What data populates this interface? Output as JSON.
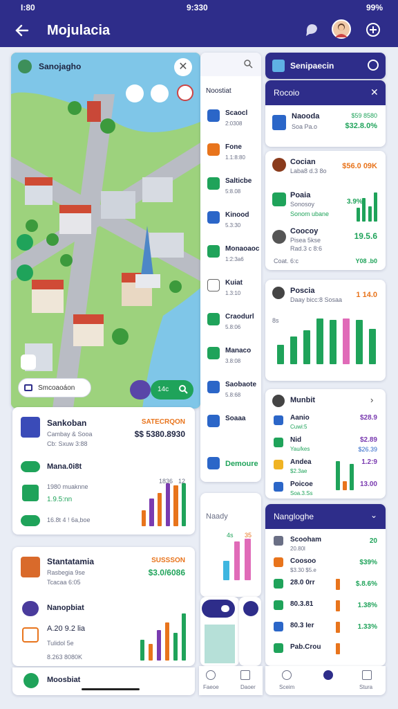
{
  "status": {
    "time_left": "I:80",
    "time_center": "9:330",
    "battery": "99%"
  },
  "app": {
    "title": "Mojulacia"
  },
  "map": {
    "title": "Sanojagho",
    "search_pill": "Smcoaoáon",
    "pill_right": "14c"
  },
  "card1": {
    "title": "Sankoban",
    "sub": "Cambay & Sooa",
    "sub2": "Cb: Sxuw 3:88",
    "price_label": "SATECRQON",
    "price": "$$ 5380.8930",
    "line2": "Mana.0i8t",
    "line3a": "1980 muaknne",
    "line3b": "1.9.5:nn",
    "line4": "16.8t 4 ! 6a,boe",
    "chart_tick_a": "1836",
    "chart_tick_b": "12",
    "chart": {
      "values": [
        30,
        52,
        62,
        80,
        76,
        80
      ],
      "colors": [
        "#e8741c",
        "#7a3bb0",
        "#e8741c",
        "#7a3bb0",
        "#e8741c",
        "#1fa35a"
      ]
    }
  },
  "card2": {
    "title": "Stantatamia",
    "sub": "Rasbegia 9se",
    "sub2": "Tcacaa 6:05",
    "price_label": "SUSSSON",
    "price": "$3.0/6086",
    "line2": "Nanopbiat",
    "line3": "A.20 9.2 lia",
    "line4": "Tulidol 5e",
    "line5": "8.263 8080K",
    "chart": {
      "values": [
        40,
        32,
        60,
        74,
        54,
        92
      ],
      "colors": [
        "#1fa35a",
        "#e8741c",
        "#7a3bb0",
        "#e8741c",
        "#1fa35a",
        "#1fa35a"
      ]
    }
  },
  "bottom_left": {
    "label": "Moosbiat"
  },
  "mid": {
    "header": "Noostiat",
    "items": [
      {
        "t": "Scaocl",
        "s": "2:0308",
        "c": "#2b66c8"
      },
      {
        "t": "Fone",
        "s": "1.1:8:80",
        "c": "#e8741c"
      },
      {
        "t": "Salticbe",
        "s": "5:8.08",
        "c": "#1fa35a"
      },
      {
        "t": "Kinood",
        "s": "5.3:30",
        "c": "#2b66c8"
      },
      {
        "t": "Monaoaoc",
        "s": "1:2:3a6",
        "c": "#1fa35a"
      },
      {
        "t": "Kuiat",
        "s": "1.3:10",
        "c": "#ffffff"
      },
      {
        "t": "Craodurl",
        "s": "5.8:06",
        "c": "#1fa35a"
      },
      {
        "t": "Manaco",
        "s": "3.8:08",
        "c": "#1fa35a"
      },
      {
        "t": "Saobaote",
        "s": "5.8:68",
        "c": "#2b66c8"
      },
      {
        "t": "Soaaa",
        "s": "",
        "c": "#2b66c8"
      }
    ],
    "footer": "Demoure",
    "card2_title": "Naady",
    "tick_a": "4s",
    "tick_b": "35",
    "chart": {
      "values": [
        38,
        76,
        82
      ],
      "colors": [
        "#3fb6e0",
        "#e06bb8",
        "#e06bb8"
      ]
    },
    "nav": [
      "Faeoe",
      "Daoer"
    ]
  },
  "right": {
    "header": "Senipaecin",
    "panel_title": "Rocoio",
    "p1": {
      "title": "Naooda",
      "sub": "Soa Pa.o",
      "val1": "$59 8580",
      "val2": "$32.8.0%"
    },
    "p2": {
      "r1": {
        "t": "Cocian",
        "s": "Laba8 d.3 8o",
        "v": "$56.0 09K"
      },
      "r2": {
        "t": "Poaia",
        "s": "Sonosoy",
        "s2": "Sonom ubane",
        "v": "3.9%"
      },
      "r3": {
        "t": "Coocoy",
        "s": "Pisea 5kse",
        "s2": "Rad.3 c 8:6",
        "v": "19.5.6"
      },
      "footer_a": "Coat. 6:c",
      "footer_b": "Y08 .b0",
      "chart": {
        "values": [
          20,
          34,
          22,
          42
        ],
        "colors": [
          "#1fa35a",
          "#1fa35a",
          "#1fa35a",
          "#1fa35a"
        ]
      }
    },
    "p3": {
      "title": "Poscia",
      "sub": "Daay bicc:8 Sosaa",
      "val": "1 14.0",
      "tick": "8s",
      "chart": {
        "values": [
          26,
          38,
          46,
          62,
          60,
          62,
          60,
          48
        ],
        "colors": [
          "#1fa35a",
          "#1fa35a",
          "#1fa35a",
          "#1fa35a",
          "#1fa35a",
          "#e06bb8",
          "#1fa35a",
          "#1fa35a"
        ]
      }
    },
    "p4": {
      "title": "Munbit",
      "rows": [
        {
          "t": "Aanio",
          "s": "Cuwi:5",
          "v": "$28.9",
          "c": "#2b66c8"
        },
        {
          "t": "Nid",
          "s": "Yau/kes",
          "v": "$2.89",
          "v2": "$26.39",
          "c": "#1fa35a"
        },
        {
          "t": "Andea",
          "s": "$2.3ae",
          "v": "1.2:9",
          "c": "#f0b323"
        },
        {
          "t": "Poicoe",
          "s": "Soa.3.Ss",
          "v": "13.00",
          "c": "#2b66c8"
        }
      ],
      "chart": {
        "values": [
          40,
          12,
          36
        ],
        "colors": [
          "#1fa35a",
          "#e8741c",
          "#1fa35a"
        ]
      }
    },
    "p5": {
      "title": "Nangloghe",
      "rows": [
        {
          "t": "Scooham",
          "s": "20.80l",
          "v": "20",
          "c": "#6a6f85"
        },
        {
          "t": "Coosoo",
          "s": "$3.30 $5.e",
          "v": "$39%",
          "c": "#e8741c"
        },
        {
          "t": "28.0 0rr",
          "s": "",
          "v": "$.8.6%",
          "c": "#1fa35a"
        },
        {
          "t": "80.3.81",
          "s": "",
          "v": "1.38%",
          "c": "#1fa35a"
        },
        {
          "t": "80.3 Ier",
          "s": "",
          "v": "1.33%",
          "c": "#2b66c8"
        },
        {
          "t": "Pab.Crou",
          "s": "",
          "v": "",
          "c": "#1fa35a"
        }
      ]
    },
    "nav": [
      "Sceim",
      "Stura"
    ]
  }
}
